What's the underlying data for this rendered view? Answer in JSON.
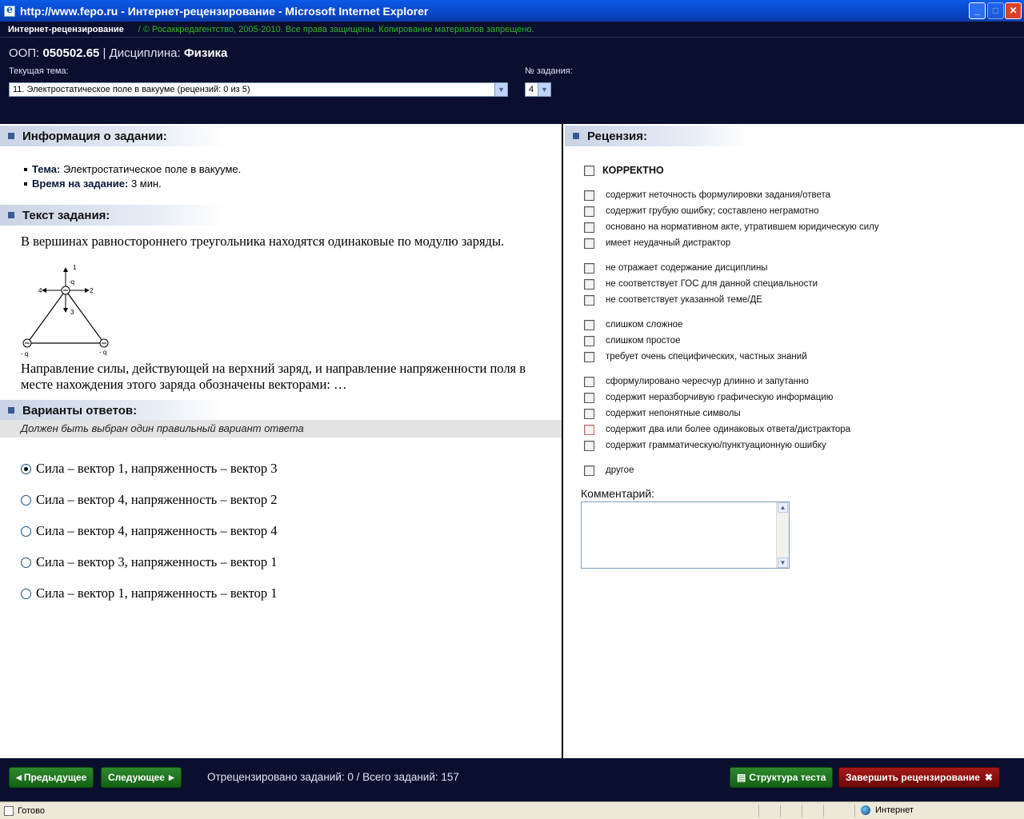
{
  "window": {
    "title": "http://www.fepo.ru - Интернет-рецензирование - Microsoft Internet Explorer"
  },
  "header": {
    "brand": "Интернет-рецензирование",
    "separator": "/",
    "copyright": "© Росаккредагентство, 2005-2010. Все права защищены. Копирование материалов запрещено.",
    "oop_label": "ООП:",
    "oop_value": "050502.65",
    "discipline_label": "| Дисциплина:",
    "discipline_value": "Физика",
    "topic_label": "Текущая тема:",
    "topic_value": "11. Электростатическое поле в вакууме  (рецензий: 0 из 5)",
    "task_no_label": "№ задания:",
    "task_no_value": "4"
  },
  "task_info": {
    "heading": "Информация о задании:",
    "topic_label": "Тема:",
    "topic_value": "Электростатическое поле в вакууме.",
    "time_label": "Время на задание:",
    "time_value": "3 мин."
  },
  "task_text": {
    "heading": "Текст задания:",
    "paragraph1": "В вершинах равностороннего треугольника находятся одинаковые по модулю заряды.",
    "paragraph2": "Направление силы, действующей на верхний заряд, и направление напряженности поля в месте нахождения этого заряда обозначены векторами: …",
    "figure": {
      "top_charge_label": "-q",
      "left_charge_label": "- q",
      "right_charge_label": "- q",
      "vector_labels": [
        "1",
        "2",
        "3",
        "4"
      ]
    }
  },
  "answers": {
    "heading": "Варианты ответов:",
    "hint": "Должен быть выбран один правильный вариант ответа",
    "options": [
      {
        "label": "Сила – вектор 1, напряженность – вектор 3",
        "selected": true
      },
      {
        "label": "Сила – вектор 4, напряженность – вектор 2",
        "selected": false
      },
      {
        "label": "Сила – вектор 4, напряженность – вектор 4",
        "selected": false
      },
      {
        "label": "Сила – вектор 3, напряженность – вектор 1",
        "selected": false
      },
      {
        "label": "Сила – вектор 1, напряженность – вектор 1",
        "selected": false
      }
    ]
  },
  "review": {
    "heading": "Рецензия:",
    "correct_label": "КОРРЕКТНО",
    "items": [
      "содержит неточность формулировки задания/ответа",
      "содержит грубую ошибку; составлено неграмотно",
      "основано на нормативном акте, утратившем юридическую силу",
      "имеет неудачный дистрактор",
      "не отражает содержание дисциплины",
      "не соответствует ГОС для данной специальности",
      "не соответствует указанной теме/ДЕ",
      "слишком сложное",
      "слишком простое",
      "требует очень специфических, частных знаний",
      "сформулировано чересчур длинно и запутанно",
      "содержит неразборчивую графическую информацию",
      "содержит непонятные символы",
      "содержит два или более одинаковых ответа/дистрактора",
      "содержит грамматическую/пунктуационную ошибку",
      "другое"
    ],
    "comment_label": "Комментарий:",
    "comment_value": ""
  },
  "footer": {
    "prev_label": "Предыдущее",
    "next_label": "Следующее",
    "progress_text": "Отрецензировано заданий: 0 / Всего заданий:  157",
    "structure_label": "Структура теста",
    "finish_label": "Завершить рецензирование"
  },
  "statusbar": {
    "status_text": "Готово",
    "zone_text": "Интернет"
  },
  "icons": {
    "prev": "triangle-left-icon",
    "next": "triangle-right-icon",
    "structure": "document-icon",
    "finish": "close-x-icon"
  },
  "colors": {
    "header_bg": "#0b0f2e",
    "copyright": "#2db52d",
    "green_button": "#146014",
    "red_button": "#8a1010"
  }
}
